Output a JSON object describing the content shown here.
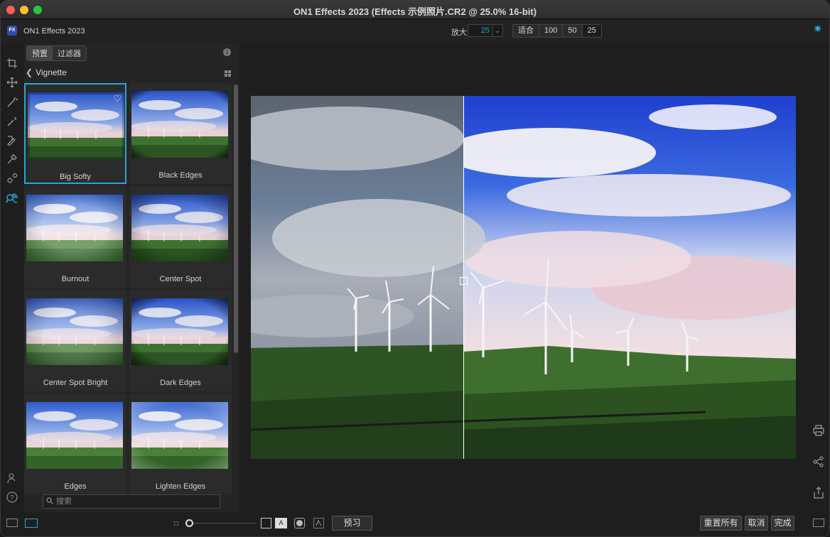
{
  "window": {
    "title": "ON1 Effects 2023 (Effects 示例照片.CR2 @ 25.0% 16-bit)"
  },
  "topbar": {
    "app_logo": "FX",
    "app_name": "ON1 Effects 2023",
    "zoom_label": "放大",
    "zoom_value": "25",
    "zoom_presets": [
      "适合",
      "100",
      "50",
      "25"
    ]
  },
  "panel": {
    "tabs": [
      "预置",
      "过滤器"
    ],
    "active_tab": "预置",
    "breadcrumb": "Vignette",
    "presets": [
      {
        "label": "Big Softy",
        "selected": true,
        "favorite": true
      },
      {
        "label": "Black Edges"
      },
      {
        "label": "Burnout"
      },
      {
        "label": "Center Spot"
      },
      {
        "label": "Center Spot Bright"
      },
      {
        "label": "Dark Edges"
      },
      {
        "label": "Edges"
      },
      {
        "label": "Lighten Edges"
      }
    ],
    "search_placeholder": "搜索"
  },
  "bottombar": {
    "preview_label": "预习",
    "reset_all_label": "重置所有",
    "cancel_label": "取消",
    "done_label": "完成"
  },
  "colors": {
    "accent": "#2aa5d8"
  }
}
